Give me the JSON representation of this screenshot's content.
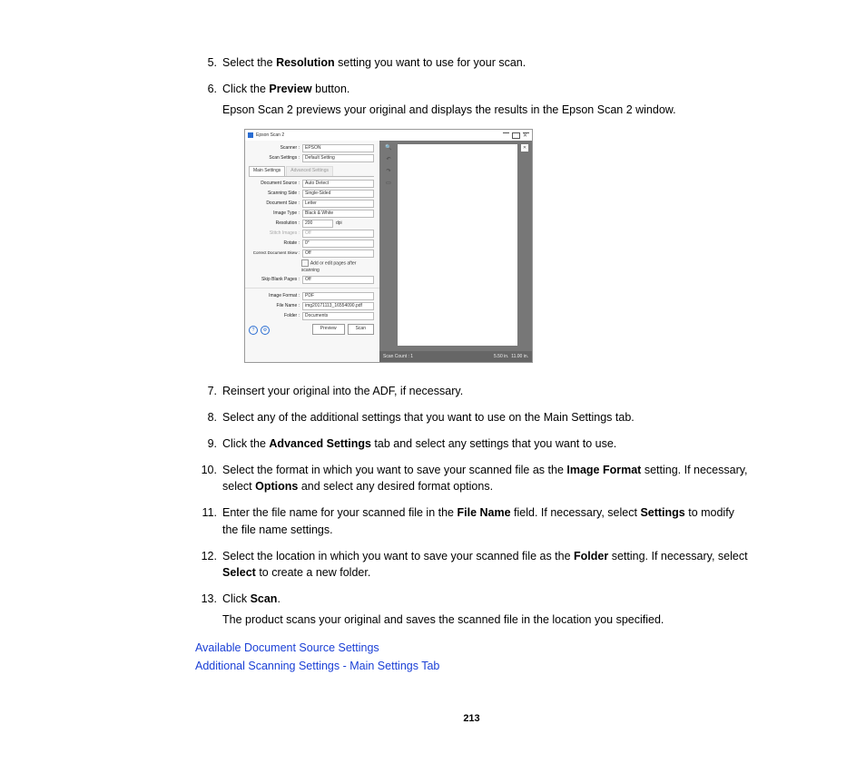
{
  "steps": {
    "s5": {
      "num": "5.",
      "text_a": "Select the ",
      "bold_a": "Resolution",
      "text_b": " setting you want to use for your scan."
    },
    "s6": {
      "num": "6.",
      "text_a": "Click the ",
      "bold_a": "Preview",
      "text_b": " button.",
      "para2": "Epson Scan 2 previews your original and displays the results in the Epson Scan 2 window."
    },
    "s7": {
      "num": "7.",
      "text": "Reinsert your original into the ADF, if necessary."
    },
    "s8": {
      "num": "8.",
      "text": "Select any of the additional settings that you want to use on the Main Settings tab."
    },
    "s9": {
      "num": "9.",
      "text_a": "Click the ",
      "bold_a": "Advanced Settings",
      "text_b": " tab and select any settings that you want to use."
    },
    "s10": {
      "num": "10.",
      "text_a": "Select the format in which you want to save your scanned file as the ",
      "bold_a": "Image Format",
      "text_b": " setting. If necessary, select ",
      "bold_b": "Options",
      "text_c": " and select any desired format options."
    },
    "s11": {
      "num": "11.",
      "text_a": "Enter the file name for your scanned file in the ",
      "bold_a": "File Name",
      "text_b": " field. If necessary, select ",
      "bold_b": "Settings",
      "text_c": " to modify the file name settings."
    },
    "s12": {
      "num": "12.",
      "text_a": "Select the location in which you want to save your scanned file as the ",
      "bold_a": "Folder",
      "text_b": " setting. If necessary, select ",
      "bold_b": "Select",
      "text_c": " to create a new folder."
    },
    "s13": {
      "num": "13.",
      "text_a": "Click ",
      "bold_a": "Scan",
      "text_b": ".",
      "para2": "The product scans your original and saves the scanned file in the location you specified."
    }
  },
  "figure": {
    "title": "Epson Scan 2",
    "scanner_lbl": "Scanner :",
    "scanner_val": "EPSON",
    "scansettings_lbl": "Scan Settings :",
    "scansettings_val": "Default Setting",
    "tab_main": "Main Settings",
    "tab_adv": "Advanced Settings",
    "docsource_lbl": "Document Source :",
    "docsource_val": "Auto Detect",
    "scanside_lbl": "Scanning Side :",
    "scanside_val": "Single-Sided",
    "docsize_lbl": "Document Size :",
    "docsize_val": "Letter",
    "imgtype_lbl": "Image Type :",
    "imgtype_val": "Black & White",
    "resolution_lbl": "Resolution :",
    "resolution_val": "200",
    "resolution_unit": "dpi",
    "stitch_lbl": "Stitch Images :",
    "stitch_val": "Off",
    "rotate_lbl": "Rotate :",
    "rotate_val": "0°",
    "skew_lbl": "Correct Document Skew :",
    "skew_val": "Off",
    "addedit_chk": "Add or edit pages after scanning",
    "skip_lbl": "Skip Blank Pages :",
    "skip_val": "Off",
    "imgfmt_lbl": "Image Format :",
    "imgfmt_val": "PDF",
    "filename_lbl": "File Name :",
    "filename_val": "img20171113_16554090.pdf",
    "folder_lbl": "Folder :",
    "folder_val": "Documents",
    "preview_btn": "Preview",
    "scan_btn": "Scan",
    "scancount": "Scan Count : 1",
    "status_size": "5.50 in.",
    "status_size2": "11.00 in."
  },
  "links": {
    "l1": "Available Document Source Settings",
    "l2": "Additional Scanning Settings - Main Settings Tab"
  },
  "page_number": "213"
}
